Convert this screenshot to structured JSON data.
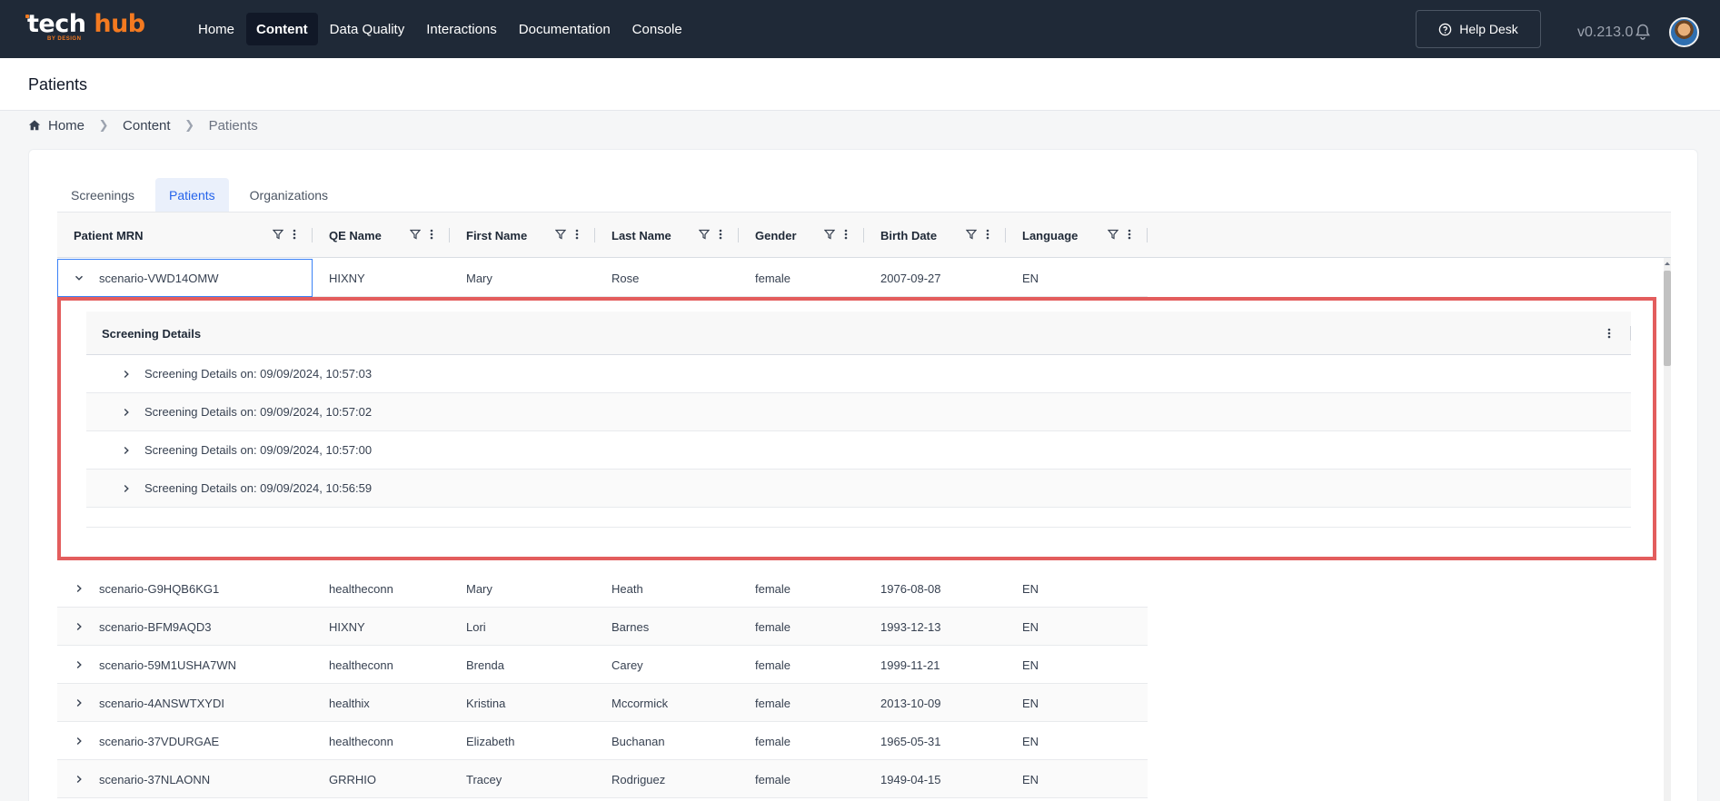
{
  "app": {
    "logo_tech": "tech",
    "logo_hub": "hub",
    "logo_sub": "BY DESIGN",
    "nav": [
      {
        "label": "Home",
        "active": false
      },
      {
        "label": "Content",
        "active": true
      },
      {
        "label": "Data Quality",
        "active": false
      },
      {
        "label": "Interactions",
        "active": false
      },
      {
        "label": "Documentation",
        "active": false
      },
      {
        "label": "Console",
        "active": false
      }
    ],
    "help_label": "Help Desk",
    "version": "v0.213.0"
  },
  "page": {
    "title": "Patients",
    "breadcrumb": [
      "Home",
      "Content",
      "Patients"
    ]
  },
  "tabs": [
    {
      "label": "Screenings",
      "active": false
    },
    {
      "label": "Patients",
      "active": true
    },
    {
      "label": "Organizations",
      "active": false
    }
  ],
  "grid": {
    "columns": [
      "Patient MRN",
      "QE Name",
      "First Name",
      "Last Name",
      "Gender",
      "Birth Date",
      "Language"
    ],
    "expanded_row": {
      "mrn": "scenario-VWD14OMW",
      "qe": "HIXNY",
      "first": "Mary",
      "last": "Rose",
      "gender": "female",
      "birth": "2007-09-27",
      "lang": "EN"
    },
    "detail": {
      "title": "Screening Details",
      "items": [
        "Screening Details on: 09/09/2024, 10:57:03",
        "Screening Details on: 09/09/2024, 10:57:02",
        "Screening Details on: 09/09/2024, 10:57:00",
        "Screening Details on: 09/09/2024, 10:56:59"
      ]
    },
    "rows": [
      {
        "mrn": "scenario-G9HQB6KG1",
        "qe": "healtheconn",
        "first": "Mary",
        "last": "Heath",
        "gender": "female",
        "birth": "1976-08-08",
        "lang": "EN"
      },
      {
        "mrn": "scenario-BFM9AQD3",
        "qe": "HIXNY",
        "first": "Lori",
        "last": "Barnes",
        "gender": "female",
        "birth": "1993-12-13",
        "lang": "EN"
      },
      {
        "mrn": "scenario-59M1USHA7WN",
        "qe": "healtheconn",
        "first": "Brenda",
        "last": "Carey",
        "gender": "female",
        "birth": "1999-11-21",
        "lang": "EN"
      },
      {
        "mrn": "scenario-4ANSWTXYDI",
        "qe": "healthix",
        "first": "Kristina",
        "last": "Mccormick",
        "gender": "female",
        "birth": "2013-10-09",
        "lang": "EN"
      },
      {
        "mrn": "scenario-37VDURGAE",
        "qe": "healtheconn",
        "first": "Elizabeth",
        "last": "Buchanan",
        "gender": "female",
        "birth": "1965-05-31",
        "lang": "EN"
      },
      {
        "mrn": "scenario-37NLAONN",
        "qe": "GRRHIO",
        "first": "Tracey",
        "last": "Rodriguez",
        "gender": "female",
        "birth": "1949-04-15",
        "lang": "EN"
      }
    ]
  },
  "colors": {
    "nav_bg": "#1f2937",
    "brand_orange": "#f47a20",
    "tab_active": "#2563eb",
    "highlight_border": "#e35d5d"
  }
}
